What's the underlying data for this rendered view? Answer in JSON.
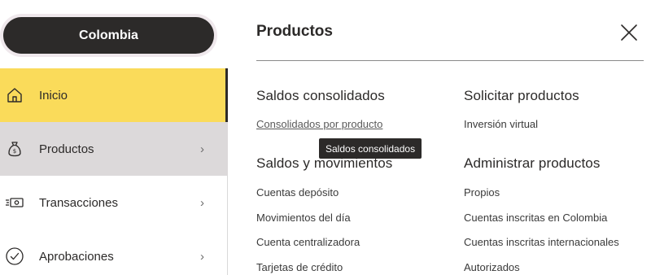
{
  "sidebar": {
    "country_label": "Colombia",
    "items": [
      {
        "label": "Inicio",
        "icon": "home-icon",
        "active": true,
        "has_chevron": false
      },
      {
        "label": "Productos",
        "icon": "money-bag-icon",
        "active": false,
        "has_chevron": true,
        "chevron": "›"
      },
      {
        "label": "Transacciones",
        "icon": "cash-transfer-icon",
        "active": false,
        "has_chevron": true,
        "chevron": "›"
      },
      {
        "label": "Aprobaciones",
        "icon": "check-circle-icon",
        "active": false,
        "has_chevron": true,
        "chevron": "›"
      }
    ]
  },
  "panel": {
    "title": "Productos",
    "close_icon": "close-icon",
    "sections": {
      "saldos_consolidados": {
        "heading": "Saldos consolidados",
        "links": [
          "Consolidados por producto"
        ]
      },
      "solicitar_productos": {
        "heading": "Solicitar productos",
        "links": [
          "Inversión virtual"
        ]
      },
      "saldos_movimientos": {
        "heading": "Saldos y movimientos",
        "links": [
          "Cuentas depósito",
          "Movimientos del día",
          "Cuenta centralizadora",
          "Tarjetas de crédito"
        ]
      },
      "administrar_productos": {
        "heading": "Administrar productos",
        "links": [
          "Propios",
          "Cuentas inscritas en Colombia",
          "Cuentas inscritas internacionales",
          "Autorizados"
        ]
      }
    },
    "tooltip": "Saldos consolidados"
  },
  "colors": {
    "active_nav": "#fadb5a",
    "hover_nav": "#dcd9da",
    "dark": "#2c2a29",
    "tooltip_bg": "#2c2a29"
  }
}
